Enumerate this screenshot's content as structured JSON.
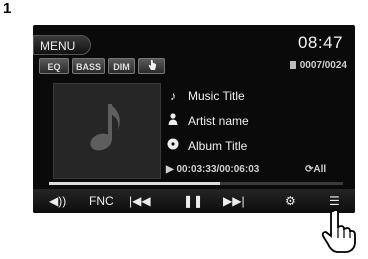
{
  "step_number": "1",
  "header": {
    "menu_label": "MENU",
    "clock": "08:47"
  },
  "toolbar": {
    "eq": "EQ",
    "bass": "BASS",
    "dim": "DIM",
    "hand_icon": "hand-icon"
  },
  "track_counter": "0007/0024",
  "media": {
    "title": "Music Title",
    "artist": "Artist name",
    "album": "Album Title",
    "time": "00:03:33/00:06:03",
    "repeat": "All",
    "progress_fraction": 0.58
  },
  "controls": {
    "volume_icon": "speaker-icon",
    "fnc_label": "FNC",
    "prev_icon": "skip-back-icon",
    "pause_icon": "pause-icon",
    "next_icon": "skip-forward-icon",
    "settings_icon": "gear-icon",
    "list_icon": "list-icon"
  },
  "colors": {
    "screen_bg": "#0a0a0a",
    "text": "#f0f0f0",
    "progress_fill": "#dcdcdc"
  }
}
